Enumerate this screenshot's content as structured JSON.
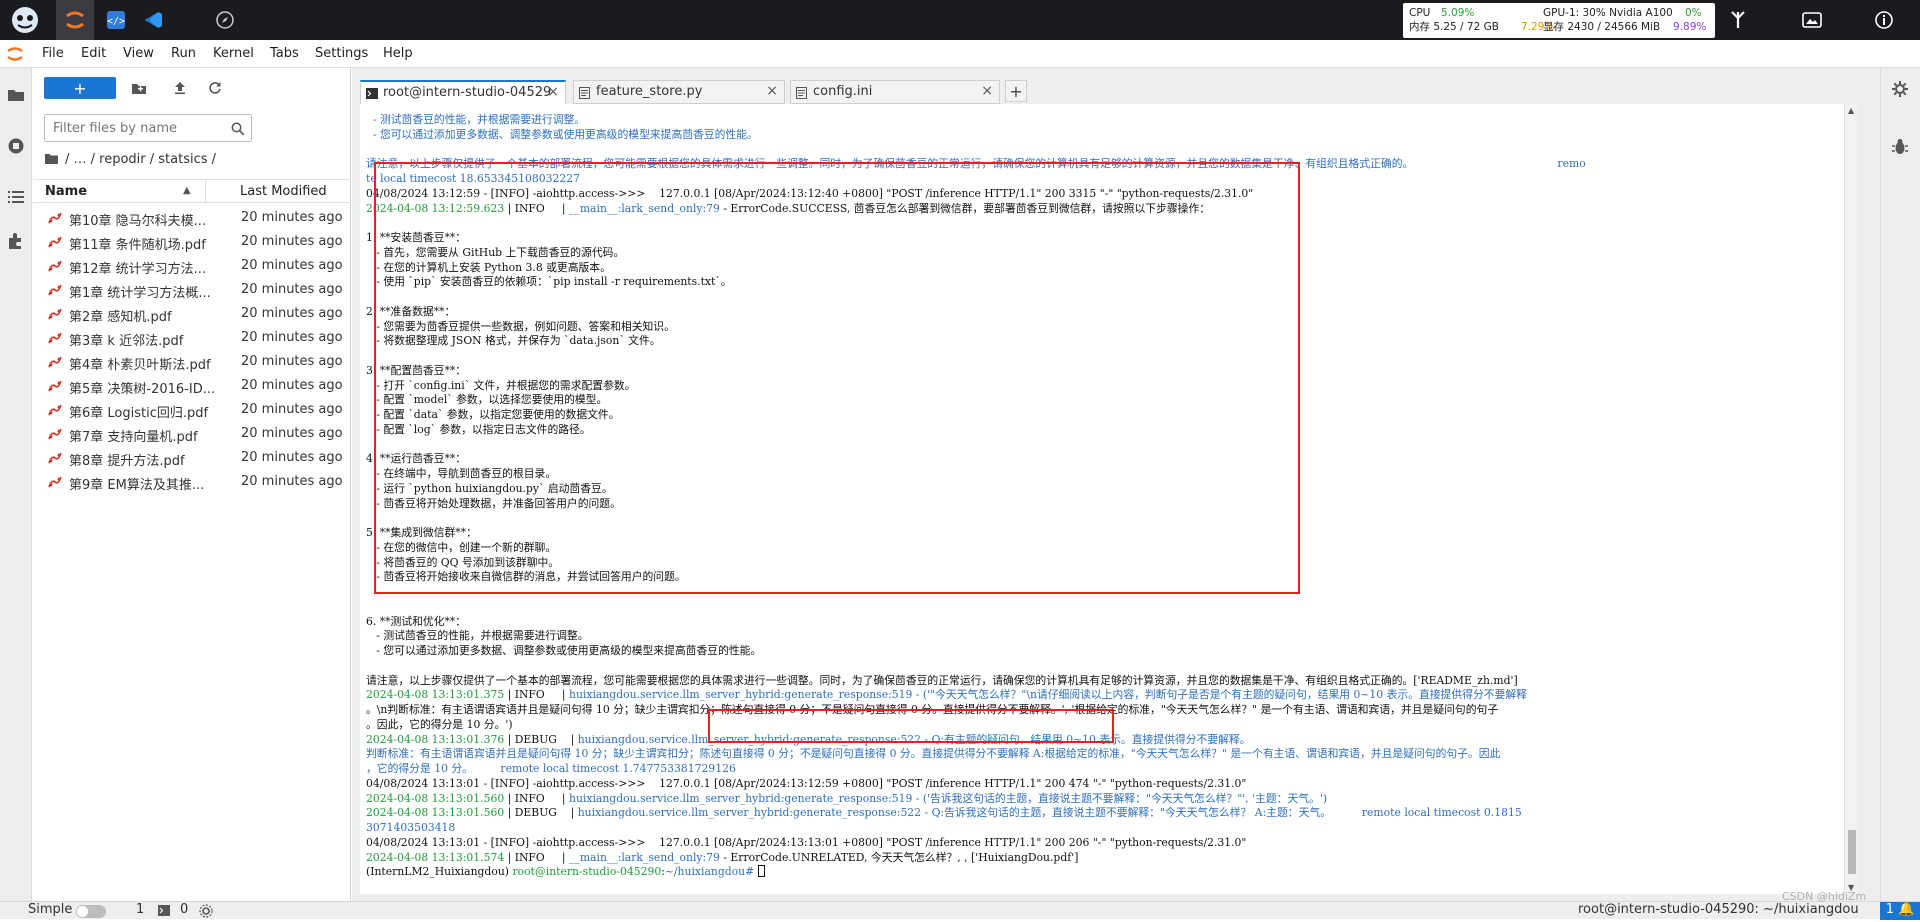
{
  "topbar": {
    "cpu_label": "CPU",
    "cpu_value": "5.09%",
    "mem_label": "内存 5.25 / 72 GB",
    "mem_value": "7.29%",
    "gpu_label": "GPU-1: 30% Nvidia A100",
    "gpu_value": "0%",
    "vram_label": "显存 2430 / 24566 MiB",
    "vram_value": "9.89%"
  },
  "menu": [
    "File",
    "Edit",
    "View",
    "Run",
    "Kernel",
    "Tabs",
    "Settings",
    "Help"
  ],
  "filebrowser": {
    "new_label": "+",
    "filter_placeholder": "Filter files by name",
    "breadcrumb": "/ … / repodir / statsics /",
    "col_name": "Name",
    "col_modified": "Last Modified",
    "files": [
      {
        "name": "第10章 隐马尔科夫模...",
        "modified": "20 minutes ago"
      },
      {
        "name": "第11章 条件随机场.pdf",
        "modified": "20 minutes ago"
      },
      {
        "name": "第12章 统计学习方法...",
        "modified": "20 minutes ago"
      },
      {
        "name": "第1章 统计学习方法概...",
        "modified": "20 minutes ago"
      },
      {
        "name": "第2章 感知机.pdf",
        "modified": "20 minutes ago"
      },
      {
        "name": "第3章 k 近邻法.pdf",
        "modified": "20 minutes ago"
      },
      {
        "name": "第4章 朴素贝叶斯法.pdf",
        "modified": "20 minutes ago"
      },
      {
        "name": "第5章 决策树-2016-ID...",
        "modified": "20 minutes ago"
      },
      {
        "name": "第6章 Logistic回归.pdf",
        "modified": "20 minutes ago"
      },
      {
        "name": "第7章 支持向量机.pdf",
        "modified": "20 minutes ago"
      },
      {
        "name": "第8章 提升方法.pdf",
        "modified": "20 minutes ago"
      },
      {
        "name": "第9章 EM算法及其推...",
        "modified": "20 minutes ago"
      }
    ]
  },
  "tabs": [
    {
      "label": "root@intern-studio-04529",
      "close": "×"
    },
    {
      "label": "feature_store.py",
      "close": "×"
    },
    {
      "label": "config.ini",
      "close": "×"
    }
  ],
  "terminal": {
    "lines": [
      {
        "t": "  - 测试茴香豆的性能，并根据需要进行调整。",
        "c": "blue"
      },
      {
        "t": "  - 您可以通过添加更多数据、调整参数或使用更高级的模型来提高茴香豆的性能。",
        "c": "blue"
      },
      {
        "t": "",
        "c": ""
      },
      {
        "t": "请注意，以上步骤仅提供了一个基本的部署流程，您可能需要根据您的具体需求进行一些调整。同时，为了确保茴香豆的正常运行，请确保您的计算机具有足够的计算资源，并且您的数据集是干净、有组织且格式正确的。                                          remo",
        "c": "blue"
      },
      {
        "t": "te local timecost 18.653345108032227",
        "c": "blue"
      },
      {
        "t": "04/08/2024 13:12:59 - [INFO] -aiohttp.access->>>    127.0.0.1 [08/Apr/2024:13:12:40 +0800] \"POST /inference HTTP/1.1\" 200 3315 \"-\" \"python-requests/2.31.0\"",
        "c": ""
      },
      {
        "t": "2024-04-08 13:12:59.623 | INFO     | __main__:lark_send_only:79 - ErrorCode.SUCCESS, 茴香豆怎么部署到微信群，要部署茴香豆到微信群，请按照以下步骤操作：",
        "c": "mixok"
      },
      {
        "t": "",
        "c": ""
      },
      {
        "t": "1. **安装茴香豆**：",
        "c": ""
      },
      {
        "t": "   - 首先，您需要从 GitHub 上下载茴香豆的源代码。",
        "c": ""
      },
      {
        "t": "   - 在您的计算机上安装 Python 3.8 或更高版本。",
        "c": ""
      },
      {
        "t": "   - 使用 `pip` 安装茴香豆的依赖项：`pip install -r requirements.txt`。",
        "c": ""
      },
      {
        "t": "",
        "c": ""
      },
      {
        "t": "2. **准备数据**：",
        "c": ""
      },
      {
        "t": "   - 您需要为茴香豆提供一些数据，例如问题、答案和相关知识。",
        "c": ""
      },
      {
        "t": "   - 将数据整理成 JSON 格式，并保存为 `data.json` 文件。",
        "c": ""
      },
      {
        "t": "",
        "c": ""
      },
      {
        "t": "3. **配置茴香豆**：",
        "c": ""
      },
      {
        "t": "   - 打开 `config.ini` 文件，并根据您的需求配置参数。",
        "c": ""
      },
      {
        "t": "   - 配置 `model` 参数，以选择您要使用的模型。",
        "c": ""
      },
      {
        "t": "   - 配置 `data` 参数，以指定您要使用的数据文件。",
        "c": ""
      },
      {
        "t": "   - 配置 `log` 参数，以指定日志文件的路径。",
        "c": ""
      },
      {
        "t": "",
        "c": ""
      },
      {
        "t": "4. **运行茴香豆**：",
        "c": ""
      },
      {
        "t": "   - 在终端中，导航到茴香豆的根目录。",
        "c": ""
      },
      {
        "t": "   - 运行 `python huixiangdou.py` 启动茴香豆。",
        "c": ""
      },
      {
        "t": "   - 茴香豆将开始处理数据，并准备回答用户的问题。",
        "c": ""
      },
      {
        "t": "",
        "c": ""
      },
      {
        "t": "5. **集成到微信群**：",
        "c": ""
      },
      {
        "t": "   - 在您的微信中，创建一个新的群聊。",
        "c": ""
      },
      {
        "t": "   - 将茴香豆的 QQ 号添加到该群聊中。",
        "c": ""
      },
      {
        "t": "   - 茴香豆将开始接收来自微信群的消息，并尝试回答用户的问题。",
        "c": ""
      },
      {
        "t": "",
        "c": ""
      },
      {
        "t": "",
        "c": ""
      },
      {
        "t": "6. **测试和优化**：",
        "c": ""
      },
      {
        "t": "   - 测试茴香豆的性能，并根据需要进行调整。",
        "c": ""
      },
      {
        "t": "   - 您可以通过添加更多数据、调整参数或使用更高级的模型来提高茴香豆的性能。",
        "c": ""
      },
      {
        "t": "",
        "c": ""
      },
      {
        "t": "请注意，以上步骤仅提供了一个基本的部署流程，您可能需要根据您的具体需求进行一些调整。同时，为了确保茴香豆的正常运行，请确保您的计算机具有足够的计算资源，并且您的数据集是干净、有组织且格式正确的。['README_zh.md']",
        "c": ""
      },
      {
        "t": "2024-04-08 13:13:01.375 | INFO     | huixiangdou.service.llm_server_hybrid:generate_response:519 - ('\"今天天气怎么样？\"\\n请仔细阅读以上内容，判断句子是否是个有主题的疑问句，结果用 0~10 表示。直接提供得分不要解释",
        "c": "mixblue"
      },
      {
        "t": "。\\n判断标准：有主语谓语宾语并且是疑问句得 10 分；缺少主谓宾扣分；陈述句直接得 0 分；不是疑问句直接得 0 分。直接提供得分不要解释。', '根据给定的标准，\"今天天气怎么样？\" 是一个有主语、谓语和宾语，并且是疑问句的句子",
        "c": ""
      },
      {
        "t": "。因此，它的得分是 10 分。')",
        "c": ""
      },
      {
        "t": "2024-04-08 13:13:01.376 | DEBUG    | huixiangdou.service.llm_server_hybrid:generate_response:522 - Q:有主题的疑问句，结果用 0~10 表示。直接提供得分不要解释。",
        "c": "mixblue"
      },
      {
        "t": "判断标准：有主语谓语宾语并且是疑问句得 10 分；缺少主谓宾扣分；陈述句直接得 0 分；不是疑问句直接得 0 分。直接提供得分不要解释 A:根据给定的标准，\"今天天气怎么样？\" 是一个有主语、谓语和宾语，并且是疑问句的句子。因此",
        "c": "blue"
      },
      {
        "t": "，它的得分是 10 分。        remote local timecost 1.747753381729126",
        "c": "blue"
      },
      {
        "t": "04/08/2024 13:13:01 - [INFO] -aiohttp.access->>>    127.0.0.1 [08/Apr/2024:13:12:59 +0800] \"POST /inference HTTP/1.1\" 200 474 \"-\" \"python-requests/2.31.0\"",
        "c": ""
      },
      {
        "t": "2024-04-08 13:13:01.560 | INFO     | huixiangdou.service.llm_server_hybrid:generate_response:519 - ('告诉我这句话的主题，直接说主题不要解释：\"今天天气怎么样？\"', '主题：天气。')",
        "c": "mixblue"
      },
      {
        "t": "2024-04-08 13:13:01.560 | DEBUG    | huixiangdou.service.llm_server_hybrid:generate_response:522 - Q:告诉我这句话的主题，直接说主题不要解释：\"今天天气怎么样？ A:主题：天气。         remote local timecost 0.1815",
        "c": "mixblue"
      },
      {
        "t": "3071403503418",
        "c": "blue"
      },
      {
        "t": "04/08/2024 13:13:01 - [INFO] -aiohttp.access->>>    127.0.0.1 [08/Apr/2024:13:13:01 +0800] \"POST /inference HTTP/1.1\" 200 206 \"-\" \"python-requests/2.31.0\"",
        "c": ""
      },
      {
        "t": "2024-04-08 13:13:01.574 | INFO     | __main__:lark_send_only:79 - ErrorCode.UNRELATED, 今天天气怎么样？, , ['HuixiangDou.pdf']",
        "c": "mixok"
      },
      {
        "t": "(InternLM2_Huixiangdou) root@intern-studio-045290:~/huixiangdou# ",
        "c": "prompt"
      }
    ]
  },
  "status": {
    "mode": "Simple",
    "count1": "1",
    "count2": "0",
    "path": "root@intern-studio-045290: ~/huixiangdou",
    "num": "1",
    "watermark": "CSDN @hidiZm"
  }
}
